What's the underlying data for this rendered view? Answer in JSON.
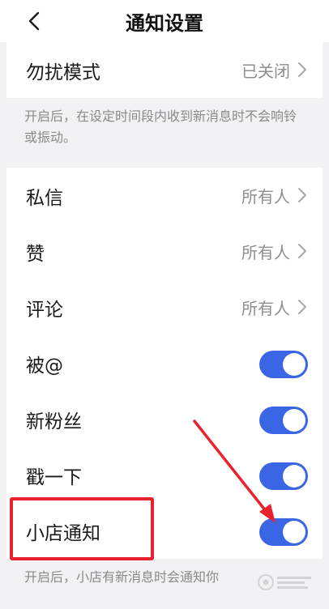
{
  "header": {
    "title": "通知设置"
  },
  "dnd": {
    "label": "勿扰模式",
    "value": "已关闭"
  },
  "dnd_note": "开启后，在设定时间段内收到新消息时不会响铃或振动。",
  "rows": [
    {
      "label": "私信",
      "value": "所有人"
    },
    {
      "label": "赞",
      "value": "所有人"
    },
    {
      "label": "评论",
      "value": "所有人"
    }
  ],
  "toggles": [
    {
      "label": "被@",
      "on": true
    },
    {
      "label": "新粉丝",
      "on": true
    },
    {
      "label": "戳一下",
      "on": true
    },
    {
      "label": "小店通知",
      "on": true
    }
  ],
  "shop_note": "开启后，小店有新消息时会通知你",
  "colors": {
    "toggle_on": "#3a66e6",
    "annotation": "#e8232f"
  }
}
